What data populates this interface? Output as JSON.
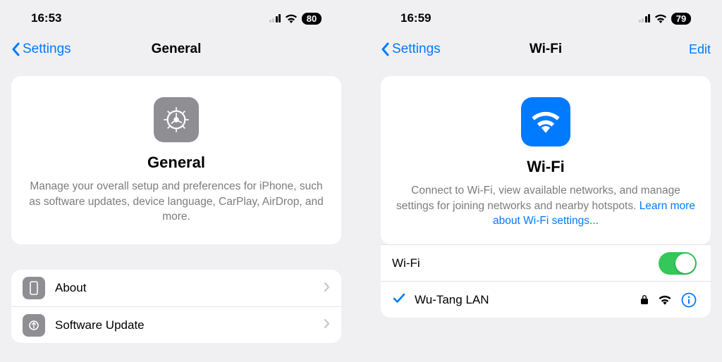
{
  "panes": [
    {
      "status": {
        "time": "16:53",
        "battery": "80"
      },
      "nav": {
        "back": "Settings",
        "title": "General"
      },
      "hero": {
        "title": "General",
        "desc": "Manage your overall setup and preferences for iPhone, such as software updates, device language, CarPlay, AirDrop, and more."
      },
      "items": [
        {
          "label": "About"
        },
        {
          "label": "Software Update"
        }
      ]
    },
    {
      "status": {
        "time": "16:59",
        "battery": "79"
      },
      "nav": {
        "back": "Settings",
        "title": "Wi-Fi",
        "action": "Edit"
      },
      "hero": {
        "title": "Wi-Fi",
        "desc_pre": "Connect to Wi-Fi, view available networks, and manage settings for joining networks and nearby hotspots. ",
        "link": "Learn more about Wi-Fi settings..."
      },
      "wifi_toggle_label": "Wi-Fi",
      "network": {
        "name": "Wu-Tang LAN"
      }
    }
  ]
}
